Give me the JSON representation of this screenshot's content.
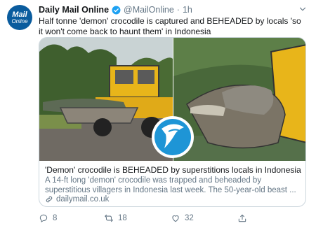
{
  "account": {
    "avatar_line1": "Mail",
    "avatar_line2": "Online",
    "name": "Daily Mail Online",
    "handle": "@MailOnline",
    "separator": "·",
    "time": "1h"
  },
  "tweet": {
    "text": "Half tonne 'demon' crocodile is captured and BEHEADED by locals 'so it won't come back to haunt them' in Indonesia"
  },
  "card": {
    "title": "'Demon' crocodile is BEHEADED by superstitions locals in Indonesia",
    "description": "A 14-ft long 'demon' crocodile was trapped and beheaded by superstitious villagers in Indonesia last week. The 50-year-old beast ...",
    "domain": "dailymail.co.uk",
    "image_icons": [
      "excavator-crocodile-photo",
      "crocodile-head-bucket-photo",
      "watermark-logo"
    ]
  },
  "actions": {
    "reply_count": "8",
    "retweet_count": "18",
    "like_count": "32"
  },
  "colors": {
    "text": "#14171a",
    "secondary": "#657786",
    "border": "#ccd6dd",
    "verified": "#1da1f2",
    "avatar": "#0a5c9e",
    "excavator_yellow": "#e8b51a"
  }
}
